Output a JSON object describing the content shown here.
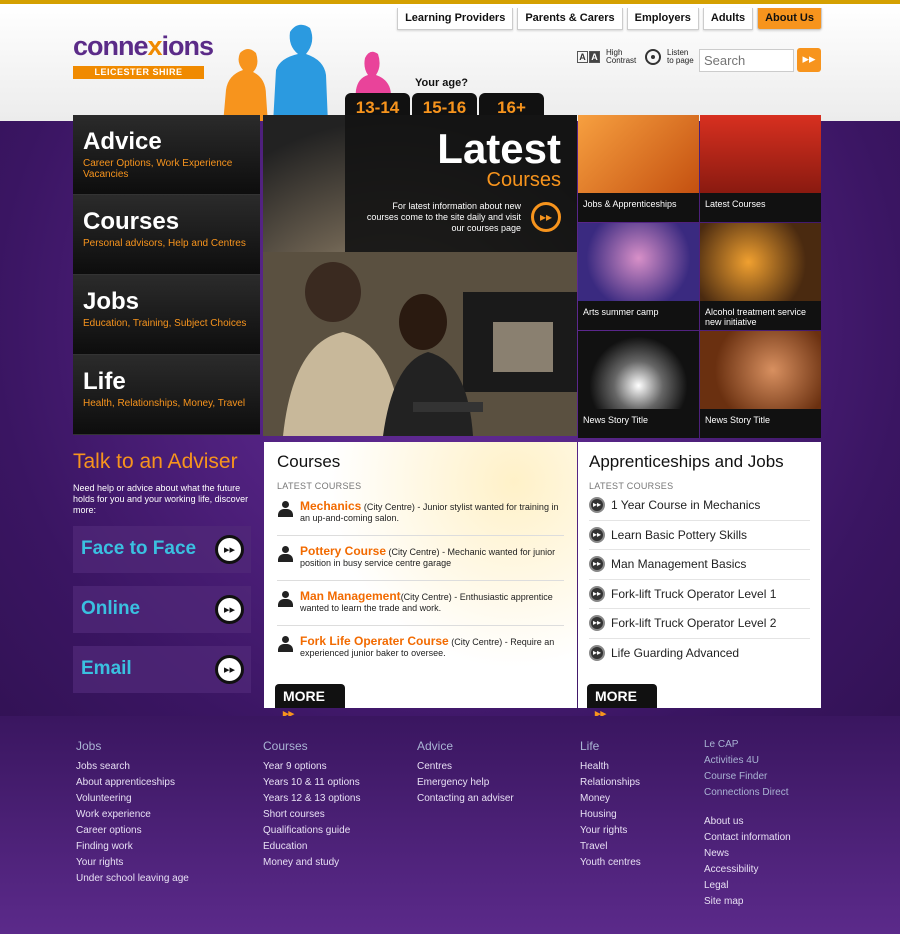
{
  "brand": {
    "logo_prefix": "conne",
    "logo_x": "x",
    "logo_suffix": "ions",
    "region": "LEICESTER SHIRE"
  },
  "topnav": [
    "Learning Providers",
    "Parents & Carers",
    "Employers",
    "Adults",
    "About Us"
  ],
  "tools": {
    "contrast_label": "High Contrast",
    "listen_label": "Listen to page",
    "search_placeholder": "Search"
  },
  "age": {
    "label": "Your age?",
    "tabs": [
      "13-14",
      "15-16",
      "16+"
    ]
  },
  "leftnav": [
    {
      "title": "Advice",
      "sub": "Career Options, Work Experience Vacancies"
    },
    {
      "title": "Courses",
      "sub": "Personal advisors, Help and Centres"
    },
    {
      "title": "Jobs",
      "sub": "Education, Training, Subject Choices"
    },
    {
      "title": "Life",
      "sub": "Health, Relationships, Money, Travel"
    }
  ],
  "hero": {
    "title": "Latest",
    "subtitle": "Courses",
    "text": "For latest information about new courses come to the site daily and visit our courses page"
  },
  "tiles": [
    "Jobs & Apprenticeships",
    "Latest Courses",
    "Arts summer camp",
    "Alcohol treatment service new initiative",
    "News Story Title",
    "News Story Title"
  ],
  "adviser": {
    "title": "Talk to an Adviser",
    "text": "Need help or advice about what the future holds for you and your working life, discover more:",
    "buttons": [
      "Face to Face",
      "Online",
      "Email"
    ]
  },
  "courses": {
    "title": "Courses",
    "sub": "LATEST COURSES",
    "items": [
      {
        "name": "Mechanics",
        "loc": "(City Centre)",
        "desc": " - Junior stylist wanted for training in an up-and-coming salon."
      },
      {
        "name": "Pottery Course",
        "loc": "(City Centre)",
        "desc": " - Mechanic wanted for junior position in busy service centre garage"
      },
      {
        "name": "Man Management",
        "loc": "(City Centre)",
        "desc": " - Enthusiastic apprentice wanted to learn the trade and work."
      },
      {
        "name": "Fork Life Operater Course",
        "loc": "(City Centre)",
        "desc": " - Require an experienced junior baker to oversee."
      }
    ],
    "more": "MORE"
  },
  "apps": {
    "title": "Apprenticeships and Jobs",
    "sub": "LATEST COURSES",
    "items": [
      "1 Year Course in Mechanics",
      "Learn Basic Pottery Skills",
      "Man Management Basics",
      "Fork-lift Truck Operator Level 1",
      "Fork-lift Truck Operator Level 2",
      "Life Guarding Advanced"
    ],
    "more": "MORE"
  },
  "footer": {
    "jobs": {
      "title": "Jobs",
      "links": [
        "Jobs search",
        "About apprenticeships",
        "Volunteering",
        "Work experience",
        "Career options",
        "Finding work",
        "Your rights",
        "Under school leaving age"
      ]
    },
    "courses": {
      "title": "Courses",
      "links": [
        "Year 9 options",
        "Years 10 & 11 options",
        "Years 12 & 13 options",
        "Short courses",
        "Qualifications guide",
        "Education",
        "Money and study"
      ]
    },
    "advice": {
      "title": "Advice",
      "links": [
        "Centres",
        "Emergency help",
        "Contacting an adviser"
      ]
    },
    "life": {
      "title": "Life",
      "links": [
        "Health",
        "Relationships",
        "Money",
        "Housing",
        "Your rights",
        "Travel",
        "Youth centres"
      ]
    },
    "partners": [
      "Le CAP",
      "Activities 4U",
      "Course Finder",
      "Connections Direct"
    ],
    "info": [
      "About us",
      "Contact information",
      "News",
      "Accessibility",
      "Legal",
      "Site map"
    ]
  }
}
